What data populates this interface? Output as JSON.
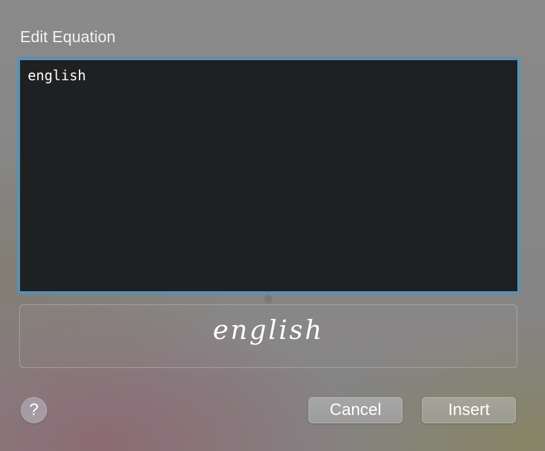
{
  "dialog": {
    "title": "Edit Equation"
  },
  "editor": {
    "value": "english"
  },
  "preview": {
    "rendered_text": "english"
  },
  "buttons": {
    "help_label": "?",
    "cancel_label": "Cancel",
    "insert_label": "Insert"
  },
  "colors": {
    "editor_border": "#5a90b6",
    "editor_background": "#1f2022"
  }
}
